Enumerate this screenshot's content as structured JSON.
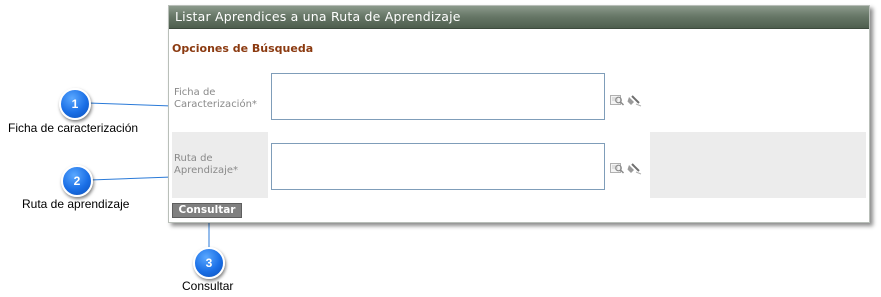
{
  "panel": {
    "title": "Listar Aprendices a una Ruta de Aprendizaje",
    "section_title": "Opciones de Búsqueda",
    "fields": [
      {
        "label_line1": "Ficha de",
        "label_line2": "Caracterización*",
        "value": ""
      },
      {
        "label_line1": "Ruta de",
        "label_line2": "Aprendizaje*",
        "value": ""
      }
    ],
    "search_button": "Consultar"
  },
  "callouts": [
    {
      "number": "1",
      "text": "Ficha de caracterización"
    },
    {
      "number": "2",
      "text": "Ruta de aprendizaje"
    },
    {
      "number": "3",
      "text": "Consultar"
    }
  ],
  "colors": {
    "titlebar": "#687868",
    "section_title": "#8b3a10",
    "badge": "#1a6fe6",
    "button": "#808080"
  },
  "icons": [
    "search-icon",
    "clear-icon"
  ]
}
